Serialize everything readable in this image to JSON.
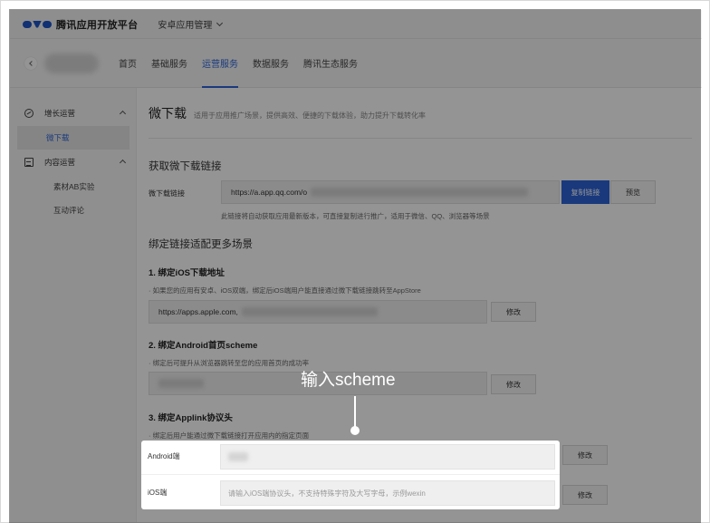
{
  "topbar": {
    "brand": "腾讯应用开放平台",
    "platform": "安卓应用管理"
  },
  "nav": {
    "tabs": [
      {
        "label": "首页",
        "active": false
      },
      {
        "label": "基础服务",
        "active": false
      },
      {
        "label": "运营服务",
        "active": true
      },
      {
        "label": "数据服务",
        "active": false
      },
      {
        "label": "腾讯生态服务",
        "active": false
      }
    ]
  },
  "sidebar": {
    "group1": "增长运营",
    "group1_item": "微下载",
    "group2": "内容运营",
    "group2_items": [
      "素材AB实验",
      "互动评论"
    ]
  },
  "page": {
    "title": "微下载",
    "desc": "适用于应用推广场景，提供高效、便捷的下载体验，助力提升下载转化率"
  },
  "link_section": {
    "heading": "获取微下载链接",
    "label": "微下载链接",
    "value": "https://a.app.qq.com/o",
    "copy_btn": "复制链接",
    "preview_btn": "预览",
    "note": "此链接将自动获取应用最新版本，可直接复制进行推广，适用于微信、QQ、浏览器等场景"
  },
  "bind_section": {
    "heading": "绑定链接适配更多场景",
    "ios": {
      "title": "1. 绑定iOS下载地址",
      "note": "· 如果您的应用有安卓、iOS双端，绑定后iOS端用户能直接通过微下载链接跳转至AppStore",
      "value": "https://apps.apple.com,",
      "btn": "修改"
    },
    "android": {
      "title": "2. 绑定Android首页scheme",
      "note": "· 绑定后可提升从浏览器跳转至您的应用首页的成功率",
      "btn": "修改"
    },
    "applink": {
      "title": "3. 绑定Applink协议头",
      "note": "· 绑定后用户能通过微下载链接打开应用内的指定页面",
      "android_label": "Android端",
      "ios_label": "iOS端",
      "ios_placeholder": "请输入iOS端协议头，不支持特殊字符及大写字母，示例wexin",
      "btn": "修改"
    }
  },
  "callout": {
    "text": "输入scheme"
  }
}
